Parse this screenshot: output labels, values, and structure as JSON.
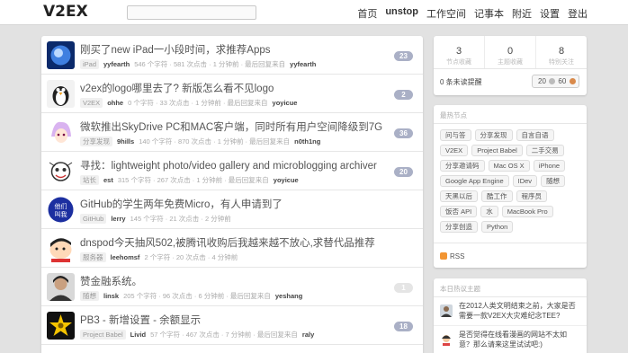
{
  "header": {
    "logo": "V2EX",
    "search": {
      "value": "",
      "placeholder": ""
    },
    "nav": [
      "首页",
      "unstop",
      "工作空间",
      "记事本",
      "附近",
      "设置",
      "登出"
    ]
  },
  "topics": [
    {
      "title": "刚买了new iPad一小段时间，求推荐Apps",
      "node": "iPad",
      "user": "yyfearth",
      "meta": "546 个字符 · 581 次点击 · 1 分钟前 · 最后回复来自",
      "last_reply": "yyfearth",
      "replies": "23",
      "avatar": "ipad-avatar"
    },
    {
      "title": "v2ex的logo哪里去了? 新版怎么看不见logo",
      "node": "V2EX",
      "user": "ohhe",
      "meta": "0 个字符 · 33 次点击 · 1 分钟前 · 最后回复来自",
      "last_reply": "yoyicue",
      "replies": "2",
      "avatar": "penguin-avatar"
    },
    {
      "title": "微软推出SkyDrive PC和MAC客户端，同时所有用户空间降级到7G",
      "node": "分享发现",
      "user": "9hills",
      "meta": "140 个字符 · 870 次点击 · 1 分钟前 · 最后回复来自",
      "last_reply": "n0th1ng",
      "replies": "36",
      "avatar": "anime-avatar"
    },
    {
      "title": "寻找：lightweight photo/video gallery and microblogging archiver",
      "node": "站长",
      "user": "est",
      "meta": "315 个字符 · 267 次点击 · 1 分钟前 · 最后回复来自",
      "last_reply": "yoyicue",
      "replies": "20",
      "avatar": "cartoon-avatar"
    },
    {
      "title": "GitHub的学生两年免费Micro，有人申请到了",
      "node": "GitHub",
      "user": "lerry",
      "meta": "145 个字符 · 21 次点击 · 2 分钟前",
      "last_reply": "",
      "replies": "",
      "avatar": "blue-circle-avatar"
    },
    {
      "title": "dnspod今天抽风502,被腾讯收购后我越来越不放心,求替代品推荐",
      "node": "服务器",
      "user": "leehomsf",
      "meta": "2 个字符 · 20 次点击 · 4 分钟前",
      "last_reply": "",
      "replies": "",
      "avatar": "shinchan-avatar"
    },
    {
      "title": "赞金融系统。",
      "node": "随想",
      "user": "linsk",
      "meta": "205 个字符 · 96 次点击 · 6 分钟前 · 最后回复来自",
      "last_reply": "yeshang",
      "replies": "1",
      "avatar": "person-avatar"
    },
    {
      "title": "PB3 - 新增设置 - 余额显示",
      "node": "Project Babel",
      "user": "Livid",
      "meta": "57 个字符 · 467 次点击 · 7 分钟前 · 最后回复来自",
      "last_reply": "raly",
      "replies": "18",
      "avatar": "star-avatar"
    }
  ],
  "sidebar": {
    "stats": [
      {
        "num": "3",
        "label": "节点收藏"
      },
      {
        "num": "0",
        "label": "主题收藏"
      },
      {
        "num": "8",
        "label": "特别关注"
      }
    ],
    "notifications": "0 条未读提醒",
    "balance": {
      "silver": "20",
      "bronze": "60"
    },
    "hot_nodes_title": "最热节点",
    "hot_nodes": [
      "问与答",
      "分享发现",
      "自言自语",
      "V2EX",
      "Project Babel",
      "二手交易",
      "分享邀请码",
      "Mac OS X",
      "iPhone",
      "Google App Engine",
      "IDev",
      "随想",
      "天黑以后",
      "酷工作",
      "程序员",
      "饭否 API",
      "水",
      "MacBook Pro",
      "分享创造",
      "Python"
    ],
    "rss": "RSS",
    "hot_topics_title": "本日热议主题",
    "hot_topics": [
      "在2012人类文明结束之前，大家是否需要一款V2EX大灾难纪念TEE?",
      "是否觉得在线看漫画的网站不太如意？那么请来这里试试吧:)"
    ]
  },
  "colors": {
    "count_badge": "#aab0c6",
    "count_badge_light": "#e5e5e5",
    "background": "#e2e2e2"
  }
}
